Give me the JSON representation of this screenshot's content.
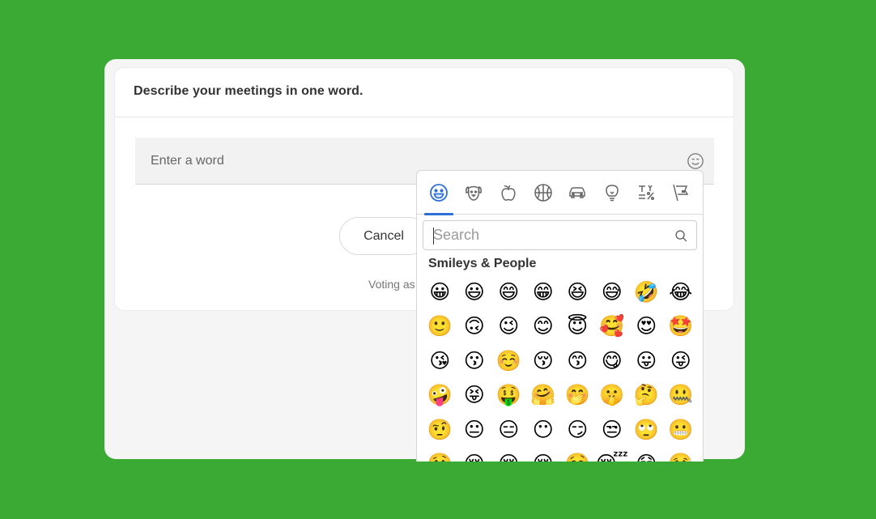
{
  "card": {
    "question": "Describe your meetings in one word.",
    "input_placeholder": "Enter a word",
    "cancel_label": "Cancel",
    "voting_text": "Voting as"
  },
  "picker": {
    "active_category": "smileys",
    "categories": [
      "smileys-people",
      "animals-nature",
      "food-drink",
      "activity",
      "travel-places",
      "objects",
      "symbols",
      "flags"
    ],
    "search_placeholder": "Search",
    "section_title": "Smileys & People",
    "emojis": [
      "😀",
      "😃",
      "😄",
      "😁",
      "😆",
      "😅",
      "🤣",
      "😂",
      "🙂",
      "🙃",
      "😉",
      "😊",
      "😇",
      "🥰",
      "😍",
      "🤩",
      "😘",
      "😗",
      "☺️",
      "😚",
      "😙",
      "😋",
      "😛",
      "😜",
      "🤪",
      "😝",
      "🤑",
      "🤗",
      "🤭",
      "🤫",
      "🤔",
      "🤐",
      "🤨",
      "😐",
      "😑",
      "😶",
      "😏",
      "😒",
      "🙄",
      "😬",
      "🤥",
      "😌",
      "😔",
      "😪",
      "🤤",
      "😴",
      "😷",
      "🤒"
    ]
  },
  "colors": {
    "background": "#3aaa35",
    "accent": "#2f6fd8"
  }
}
